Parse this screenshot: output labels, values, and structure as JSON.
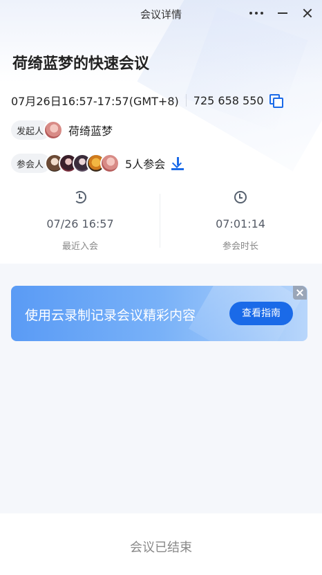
{
  "window": {
    "title": "会议详情",
    "more_icon": "more-horizontal-icon",
    "minimize_icon": "minimize-icon",
    "close_icon": "close-icon"
  },
  "meeting": {
    "title": "荷绮蓝梦的快速会议",
    "time": "07月26日16:57-17:57(GMT+8)",
    "id": "725 658 550",
    "copy_icon": "copy-icon"
  },
  "host": {
    "label": "发起人",
    "name": "荷绮蓝梦"
  },
  "participants": {
    "label": "参会人",
    "count_text": "5人参会",
    "download_icon": "download-icon"
  },
  "stats": {
    "recent_join": {
      "value": "07/26 16:57",
      "label": "最近入会",
      "icon": "history-icon"
    },
    "duration": {
      "value": "07:01:14",
      "label": "参会时长",
      "icon": "clock-icon"
    }
  },
  "banner": {
    "text": "使用云录制记录会议精彩内容",
    "button": "查看指南"
  },
  "footer": {
    "status": "会议已结束"
  },
  "colors": {
    "accent": "#1a6ae8",
    "banner_gradient_start": "#5a9bf5",
    "banner_gradient_end": "#b8d6fb"
  }
}
